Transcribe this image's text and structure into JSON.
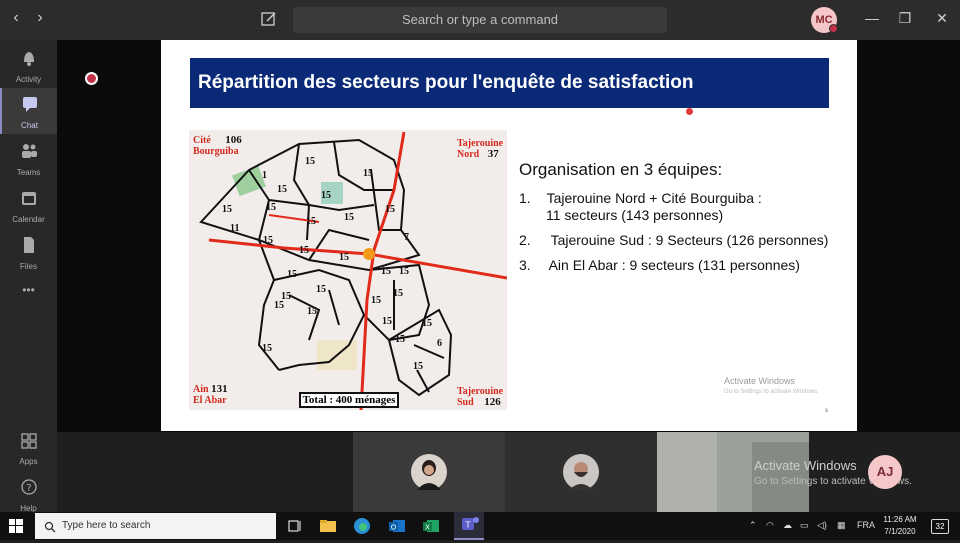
{
  "topbar": {
    "back": "‹",
    "forward": "›",
    "search_placeholder": "Search or type a command",
    "avatar_initials": "MC",
    "minimize": "—",
    "restore": "❐",
    "close": "✕"
  },
  "rail": {
    "items": [
      {
        "label": "Activity",
        "icon": "bell-icon"
      },
      {
        "label": "Chat",
        "icon": "chat-icon"
      },
      {
        "label": "Teams",
        "icon": "teams-icon"
      },
      {
        "label": "Calendar",
        "icon": "calendar-icon"
      },
      {
        "label": "Files",
        "icon": "files-icon"
      },
      {
        "label": "",
        "icon": "more-icon"
      },
      {
        "label": "Apps",
        "icon": "apps-icon"
      },
      {
        "label": "Help",
        "icon": "help-icon"
      }
    ],
    "more": "•••"
  },
  "slide": {
    "title": "Répartition des secteurs pour l'enquête de satisfaction",
    "map": {
      "corners": {
        "top_left_name1": "Cité",
        "top_left_name2": "Bourguiba",
        "top_left_count": "106",
        "top_right_name1": "Tajerouine",
        "top_right_name2": "Nord",
        "top_right_count": "37",
        "bottom_left_name1": "Ain",
        "bottom_left_name2": "El Abar",
        "bottom_left_count": "131",
        "bottom_right_name1": "Tajerouine",
        "bottom_right_name2": "Sud",
        "bottom_right_count": "126"
      },
      "total": "Total : 400 ménages",
      "sector_labels": [
        "15",
        "1",
        "15",
        "15",
        "15",
        "15",
        "15",
        "15",
        "11",
        "15",
        "15",
        "15",
        "15",
        "7",
        "15",
        "15",
        "15",
        "15",
        "15",
        "15",
        "15",
        "15",
        "15",
        "15",
        "15",
        "15",
        "15",
        "15",
        "6",
        "15"
      ]
    },
    "org": {
      "heading": "Organisation en  3 équipes:",
      "items": [
        {
          "num": "1.",
          "line1": "Tajerouine Nord + Cité Bourguiba :",
          "line2": "11 secteurs (143 personnes)"
        },
        {
          "num": "2.",
          "line1": "Tajerouine Sud : 9 Secteurs (126 personnes)",
          "line2": ""
        },
        {
          "num": "3.",
          "line1": "Ain El Abar : 9 secteurs (131 personnes)",
          "line2": ""
        }
      ]
    },
    "watermark_line1": "Activate Windows",
    "watermark_line2": "Go to Settings to activate Windows.",
    "page_mark": "s"
  },
  "participants": {
    "watermark_line1": "Activate Windows",
    "watermark_line2": "Go to Settings to activate Windows.",
    "aj_initials": "AJ"
  },
  "taskbar": {
    "search_placeholder": "Type here to search",
    "lang": "FRA",
    "time": "11:26 AM",
    "date": "7/1/2020",
    "notifications": "32"
  },
  "colors": {
    "title_bar": "#0a2a78",
    "road": "#e22a1a",
    "accent": "#8b8cc7"
  }
}
